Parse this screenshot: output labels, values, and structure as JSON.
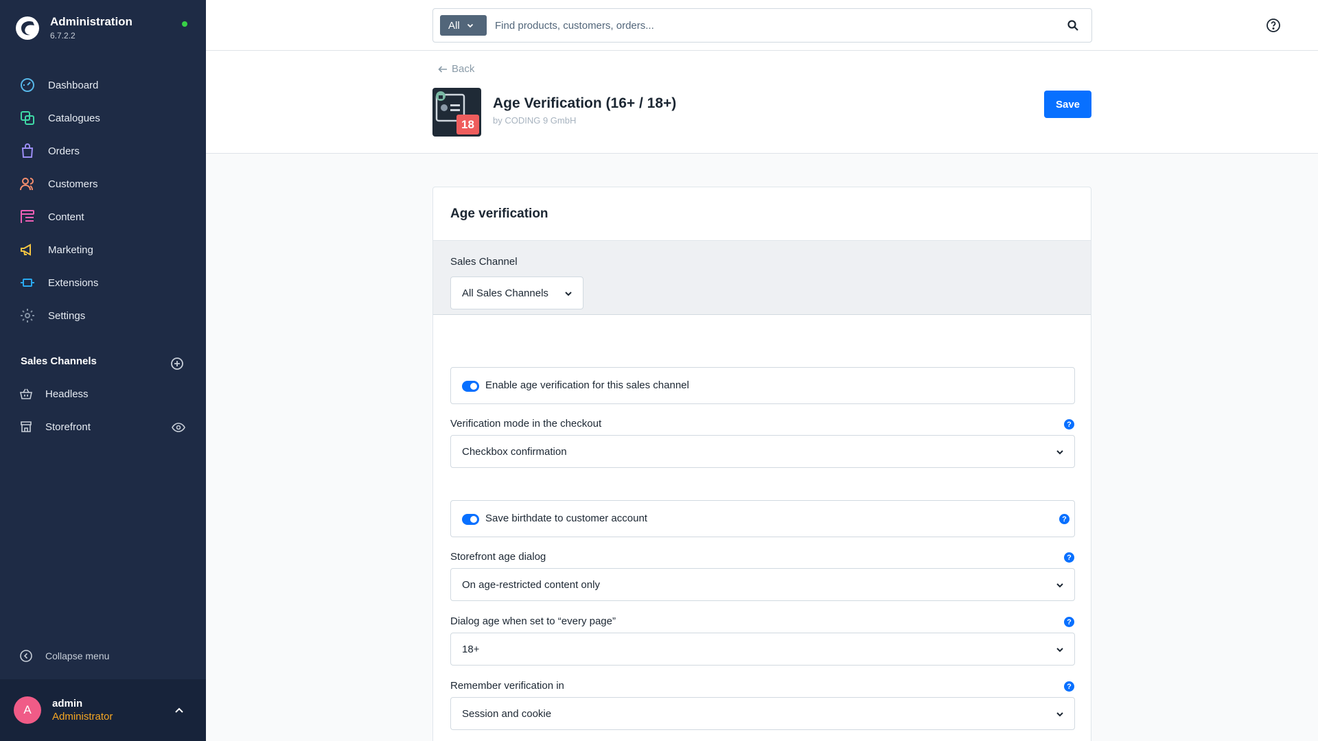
{
  "app": {
    "title": "Administration",
    "version": "6.7.2.2"
  },
  "sidebar": {
    "nav": [
      {
        "label": "Dashboard",
        "icon": "dashboard-icon",
        "color": "#57b7e8"
      },
      {
        "label": "Catalogues",
        "icon": "catalogue-icon",
        "color": "#3fd9a6"
      },
      {
        "label": "Orders",
        "icon": "orders-icon",
        "color": "#9b8df5"
      },
      {
        "label": "Customers",
        "icon": "customers-icon",
        "color": "#f48e6e"
      },
      {
        "label": "Content",
        "icon": "content-icon",
        "color": "#ec5fb5"
      },
      {
        "label": "Marketing",
        "icon": "marketing-icon",
        "color": "#f5c542"
      },
      {
        "label": "Extensions",
        "icon": "extensions-icon",
        "color": "#2aa9f0"
      },
      {
        "label": "Settings",
        "icon": "settings-icon",
        "color": "#8391a3"
      }
    ],
    "sales_channels_title": "Sales Channels",
    "sales_channels": [
      {
        "label": "Headless",
        "icon": "basket-icon"
      },
      {
        "label": "Storefront",
        "icon": "storefront-icon"
      }
    ],
    "collapse_label": "Collapse menu",
    "user": {
      "initial": "A",
      "name": "admin",
      "role": "Administrator"
    }
  },
  "topbar": {
    "search_type": "All",
    "search_placeholder": "Find products, customers, orders..."
  },
  "header": {
    "back_label": "Back",
    "extension_badge": "18",
    "title": "Age Verification (16+ / 18+)",
    "subtitle": "by CODING 9 GmbH",
    "save_label": "Save"
  },
  "card": {
    "title": "Age verification",
    "sales_channel_label": "Sales Channel",
    "sales_channel_value": "All Sales Channels",
    "enable_toggle_label": "Enable age verification for this sales channel",
    "enable_toggle_on": true,
    "verification_mode_label": "Verification mode in the checkout",
    "verification_mode_value": "Checkbox confirmation",
    "save_birthdate_label": "Save birthdate to customer account",
    "save_birthdate_on": true,
    "dialog_label": "Storefront age dialog",
    "dialog_value": "On age-restricted content only",
    "dialog_age_label": "Dialog age when set to “every page”",
    "dialog_age_value": "18+",
    "remember_label": "Remember verification in",
    "remember_value": "Session and cookie"
  },
  "colors": {
    "sidebar_bg": "#1e2b45",
    "accent": "#0870ff",
    "role": "#f5a623",
    "status_online": "#37d046"
  }
}
